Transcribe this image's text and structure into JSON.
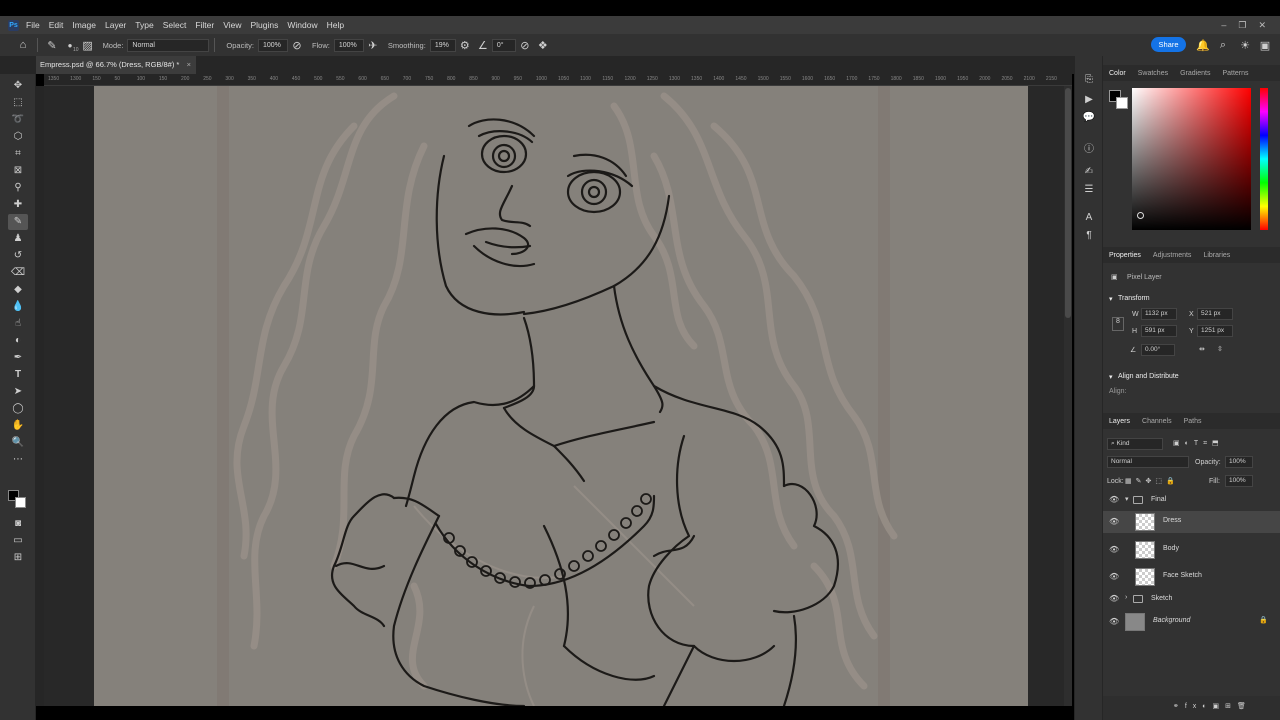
{
  "menubar": {
    "logo": "Ps",
    "items": [
      "File",
      "Edit",
      "Image",
      "Layer",
      "Type",
      "Select",
      "Filter",
      "View",
      "Plugins",
      "Window",
      "Help"
    ],
    "window_controls": [
      "–",
      "❐",
      "✕"
    ]
  },
  "options": {
    "brush_size": "10",
    "mode_label": "Mode:",
    "mode_value": "Normal",
    "opacity_label": "Opacity:",
    "opacity_value": "100%",
    "flow_label": "Flow:",
    "flow_value": "100%",
    "smoothing_label": "Smoothing:",
    "smoothing_value": "19%",
    "angle_value": "0°",
    "share_label": "Share"
  },
  "document": {
    "tab_title": "Empress.psd @ 66.7% (Dress, RGB/8#) *",
    "close": "×"
  },
  "ruler": {
    "ticks": [
      "1350",
      "1300",
      "150",
      "50",
      "100",
      "150",
      "200",
      "250",
      "300",
      "350",
      "400",
      "450",
      "500",
      "550",
      "600",
      "650",
      "700",
      "750",
      "800",
      "850",
      "900",
      "950",
      "1000",
      "1050",
      "1100",
      "1150",
      "1200",
      "1250",
      "1300",
      "1350",
      "1400",
      "1450",
      "1500",
      "1550",
      "1600",
      "1650",
      "1700",
      "1750",
      "1800",
      "1850",
      "1900",
      "1950",
      "2000",
      "2050",
      "2100",
      "2150"
    ]
  },
  "color_panel": {
    "tabs": [
      "Color",
      "Swatches",
      "Gradients",
      "Patterns"
    ],
    "hue_color": "#ff0000"
  },
  "properties": {
    "tabs": [
      "Properties",
      "Adjustments",
      "Libraries"
    ],
    "layer_kind": "Pixel Layer",
    "transform_title": "Transform",
    "w_label": "W",
    "w_value": "1132 px",
    "h_label": "H",
    "h_value": "591 px",
    "x_label": "X",
    "x_value": "521 px",
    "y_label": "Y",
    "y_value": "1251 px",
    "angle_value": "0.00°",
    "align_title": "Align and Distribute",
    "align_label": "Align:"
  },
  "layers_panel": {
    "tabs": [
      "Layers",
      "Channels",
      "Paths"
    ],
    "filter_label": "Kind",
    "blend_mode": "Normal",
    "opacity_label": "Opacity:",
    "opacity_value": "100%",
    "lock_label": "Lock:",
    "fill_label": "Fill:",
    "fill_value": "100%",
    "layers": [
      {
        "name": "Final",
        "type": "group"
      },
      {
        "name": "Dress",
        "type": "pixel"
      },
      {
        "name": "Body",
        "type": "pixel"
      },
      {
        "name": "Face Sketch",
        "type": "pixel"
      },
      {
        "name": "Sketch",
        "type": "group"
      },
      {
        "name": "Background",
        "type": "background"
      }
    ]
  }
}
